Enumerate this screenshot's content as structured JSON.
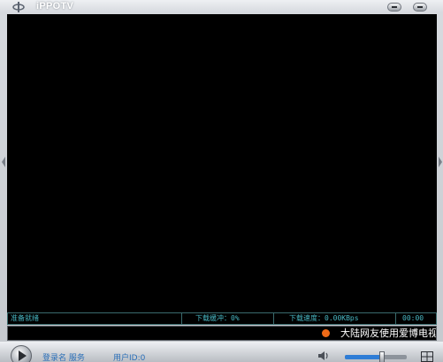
{
  "window": {
    "title": "iPPOTV",
    "minimize_label": "",
    "close_label": ""
  },
  "status": {
    "state": "准备就绪",
    "buffer": "下载缓冲：0%",
    "speed": "下载速度：0.00KBps",
    "time": "00:00"
  },
  "ticker": {
    "message": "大陆网友使用爱博电视"
  },
  "controls": {
    "login_text": "登录名 服务",
    "user_id_text": "用户ID:0",
    "volume_level": 0.6
  },
  "colors": {
    "status_text": "#49b8c4",
    "ticker_dot": "#ef6a17",
    "volume_fill": "#2f7dd6"
  },
  "icons": {
    "logo": "ippotv-logo-icon",
    "play": "play-icon",
    "speaker": "speaker-icon",
    "playlist": "grid-icon"
  }
}
